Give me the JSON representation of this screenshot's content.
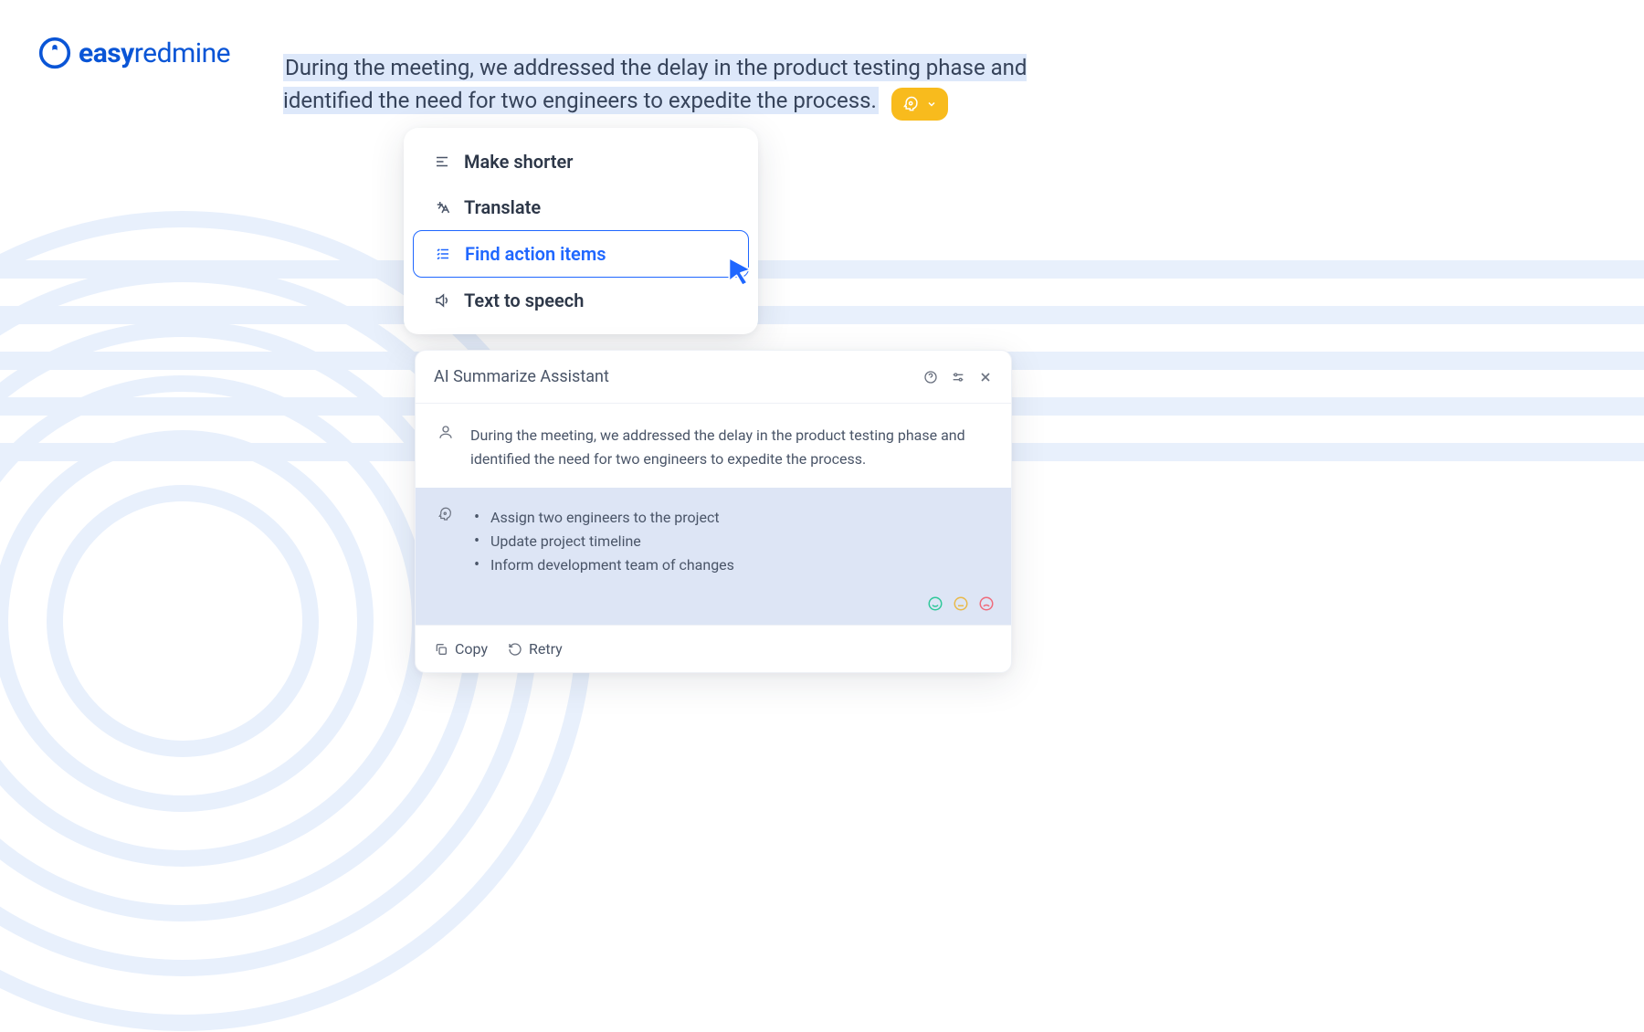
{
  "logo": {
    "brand_left": "easy",
    "brand_right": "redmine"
  },
  "selected_text": "During the meeting, we addressed the delay in the product testing phase and identified the need for two engineers to expedite the process.",
  "menu": {
    "items": [
      {
        "label": "Make shorter",
        "icon": "shorten-icon",
        "active": false
      },
      {
        "label": "Translate",
        "icon": "translate-icon",
        "active": false
      },
      {
        "label": "Find action items",
        "icon": "checklist-icon",
        "active": true
      },
      {
        "label": "Text to speech",
        "icon": "speaker-icon",
        "active": false
      }
    ]
  },
  "assistant": {
    "title": "AI Summarize Assistant",
    "user_text": "During the meeting, we addressed the delay in the product testing phase and identified the need for two engineers to expedite the process.",
    "ai_items": [
      "Assign two engineers to the project",
      "Update project timeline",
      "Inform development team of changes"
    ],
    "footer": {
      "copy": "Copy",
      "retry": "Retry"
    }
  },
  "colors": {
    "brand_blue": "#0a55d6",
    "accent_yellow": "#f8bb1d",
    "selection_bg": "#dde8fa",
    "ai_block_bg": "#dde5f5"
  }
}
